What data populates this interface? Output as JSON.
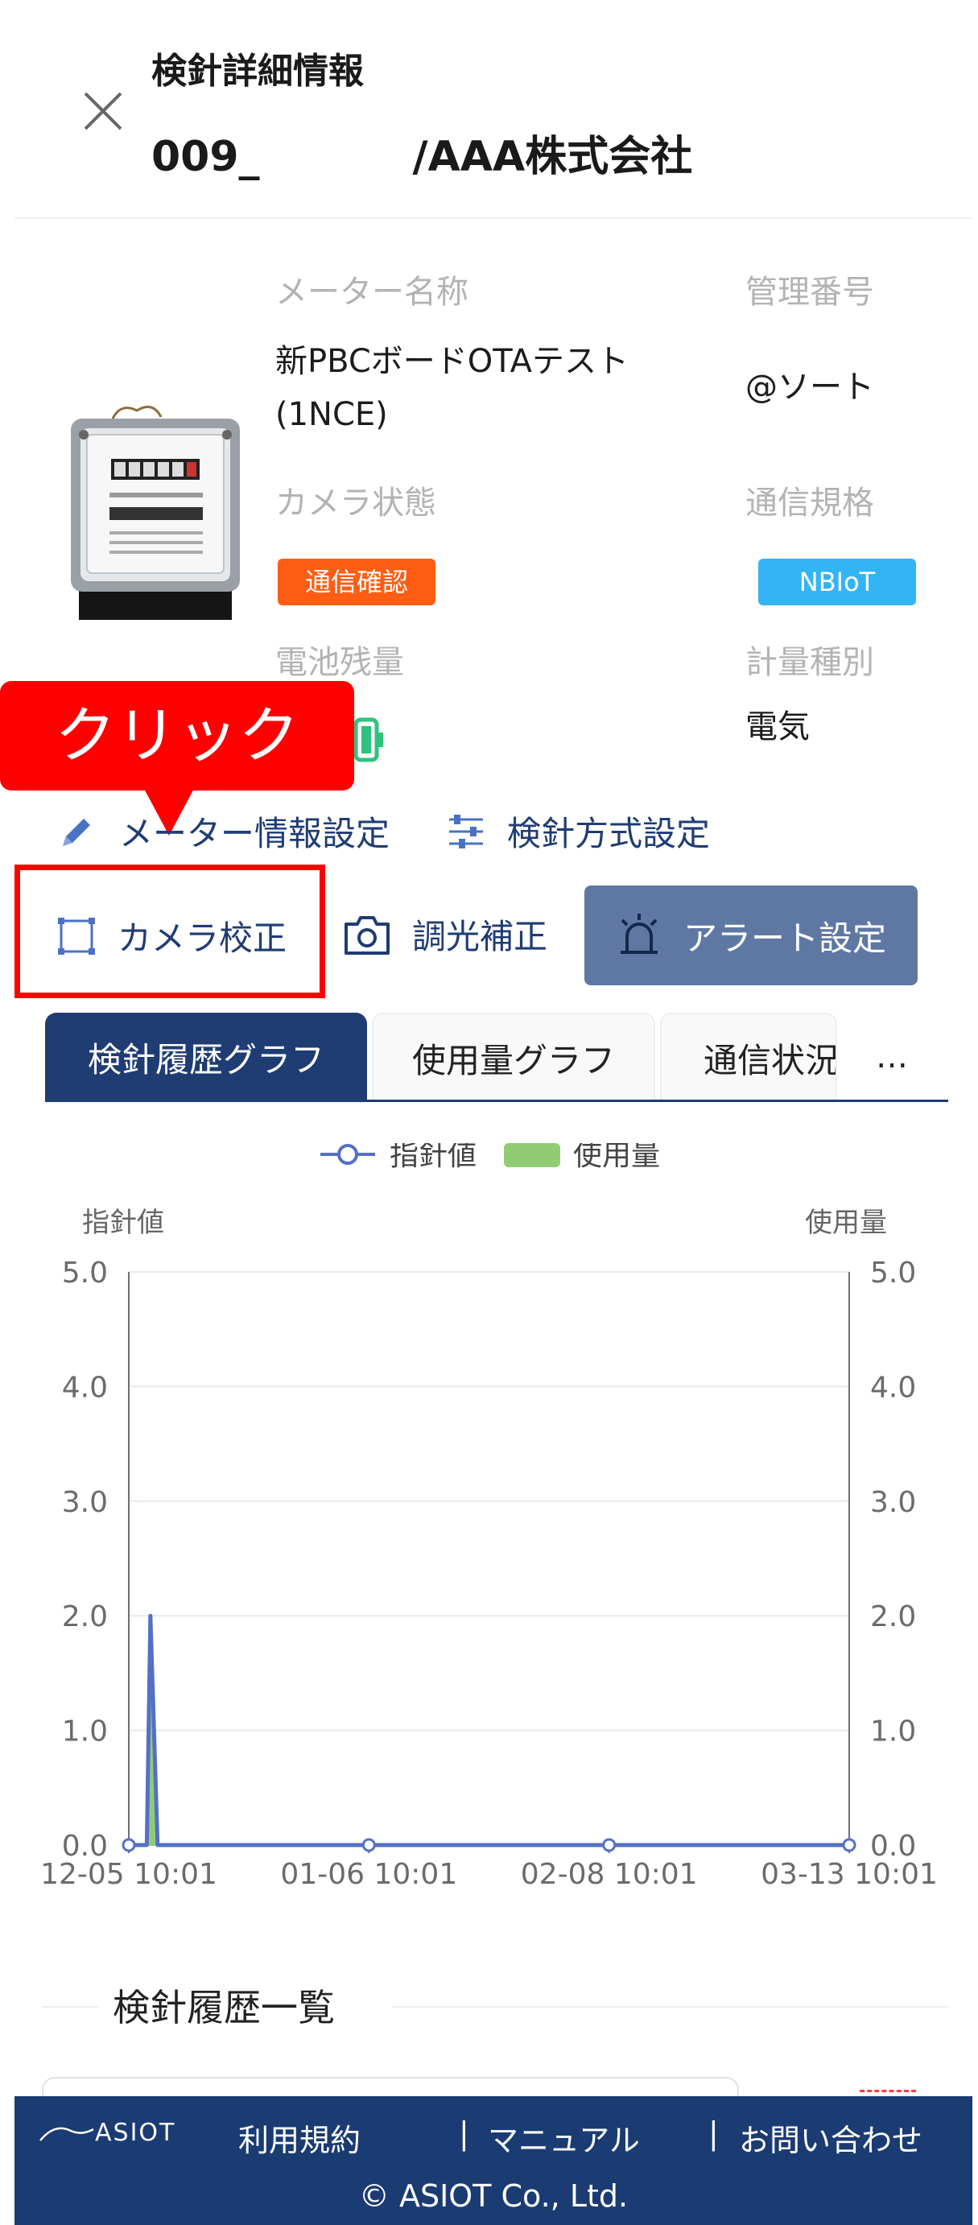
{
  "header": {
    "title": "検針詳細情報",
    "subtitle_prefix": "009_",
    "subtitle_suffix": "/AAA株式会社"
  },
  "meter": {
    "name_label": "メーター名称",
    "name_line1": "新PBCボードOTAテスト",
    "name_line2": "(1NCE)",
    "mgmt_label": "管理番号",
    "mgmt_value": "@ソート",
    "camera_label": "カメラ状態",
    "camera_value": "通信確認",
    "comm_label": "通信規格",
    "comm_value": "NBIoT",
    "battery_label": "電池残量",
    "measure_label": "計量種別",
    "measure_value": "電気"
  },
  "annotation": {
    "callout": "クリック"
  },
  "actions": {
    "meter_info": "メーター情報設定",
    "reading_method": "検針方式設定",
    "camera_calib": "カメラ校正",
    "light_correction": "調光補正",
    "alert_settings": "アラート設定"
  },
  "tabs": [
    {
      "label": "検針履歴グラフ"
    },
    {
      "label": "使用量グラフ"
    },
    {
      "label": "通信状況"
    }
  ],
  "tab_more": "…",
  "chart_data": {
    "type": "line",
    "legend": [
      "指針値",
      "使用量"
    ],
    "legend_position": "top-center",
    "ylabel_left": "指針値",
    "ylabel_right": "使用量",
    "ylim": [
      0,
      5
    ],
    "yticks": [
      "0.0",
      "1.0",
      "2.0",
      "3.0",
      "4.0",
      "5.0"
    ],
    "xticks": [
      "12-05 10:01",
      "01-06 10:01",
      "02-08 10:01",
      "03-13 10:01"
    ],
    "grid": true,
    "series": [
      {
        "name": "指針値",
        "type": "line",
        "color": "#5470c6",
        "points": [
          [
            0,
            0
          ],
          [
            0.025,
            0
          ],
          [
            0.03,
            2.0
          ],
          [
            0.04,
            0
          ],
          [
            0.333,
            0
          ],
          [
            0.667,
            0
          ],
          [
            1.0,
            0
          ]
        ]
      },
      {
        "name": "使用量",
        "type": "area",
        "color": "#91cc75",
        "points": [
          [
            0.025,
            0
          ],
          [
            0.03,
            2.0
          ],
          [
            0.04,
            0
          ]
        ]
      }
    ]
  },
  "history": {
    "title": "検針履歴一覧"
  },
  "footer": {
    "logo": "ASIOT",
    "terms": "利用規約",
    "manual": "マニュアル",
    "contact": "お問い合わせ",
    "separator": "|",
    "copyright": "© ASIOT Co., Ltd."
  },
  "colors": {
    "navy": "#1f3c73",
    "footer_bg": "#1b3b73",
    "alert_bg": "#5f78a3",
    "badge_orange": "#ff5d14",
    "badge_blue": "#33b4f5",
    "annotation_red": "#ff0000",
    "battery_green": "#2ec27e"
  }
}
